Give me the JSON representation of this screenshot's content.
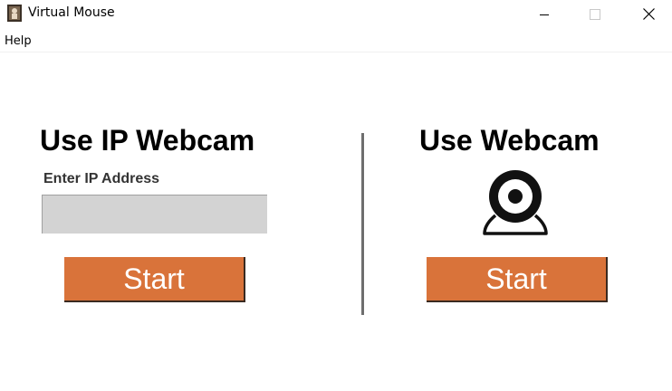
{
  "window": {
    "title": "Virtual Mouse",
    "controls": {
      "minimize": "minimize-icon",
      "maximize": "maximize-icon",
      "close": "close-icon"
    }
  },
  "menu": {
    "items": [
      {
        "label": "Help"
      }
    ]
  },
  "ip_panel": {
    "heading": "Use IP Webcam",
    "input_label": "Enter IP Address",
    "input_value": "",
    "start_label": "Start"
  },
  "webcam_panel": {
    "heading": "Use Webcam",
    "icon": "webcam-icon",
    "start_label": "Start"
  },
  "colors": {
    "button_bg": "#d9733a",
    "input_bg": "#d3d3d3",
    "divider": "#6e6e6e"
  }
}
